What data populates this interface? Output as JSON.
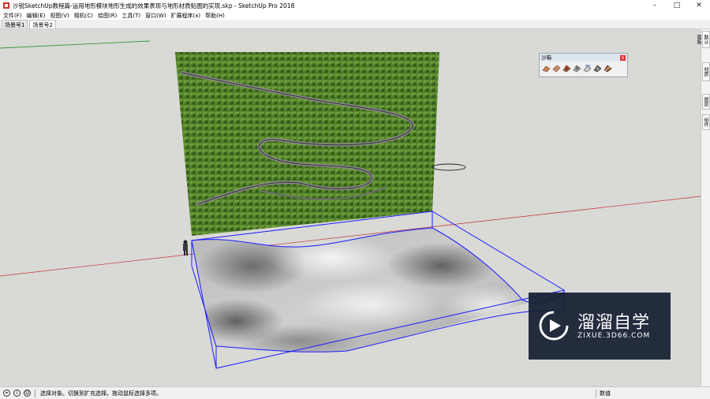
{
  "window": {
    "title": "沙锐SketchUp教程篇-运用地形模块地形生成的效果表现与地形材质贴图的实现.skp - SketchUp Pro 2018",
    "minimize": "–",
    "maximize": "□",
    "close": "✕"
  },
  "menu": {
    "items": [
      "文件(F)",
      "编辑(E)",
      "视图(V)",
      "相机(C)",
      "绘图(R)",
      "工具(T)",
      "窗口(W)",
      "扩展程序(x)",
      "帮助(H)"
    ]
  },
  "scenes": {
    "tabs": [
      "场景号1",
      "场景号2"
    ]
  },
  "sandbox": {
    "title": "沙箱",
    "close": "x",
    "tools": [
      "from-contours-icon",
      "from-scratch-icon",
      "smoove-icon",
      "stamp-icon",
      "drape-icon",
      "add-detail-icon",
      "flip-edge-icon"
    ]
  },
  "tray": {
    "tabs": [
      "默认面板",
      "材质",
      "图层",
      "组件"
    ]
  },
  "status": {
    "message": "选择对象。切换到扩充选择。拖动鼠标选择多项。",
    "measure_label": "数值"
  },
  "watermark": {
    "title": "溜溜自学",
    "url": "ZIXUE.3D66.COM"
  },
  "colors": {
    "viewport_bg": "#d9d9d6",
    "selection_blue": "#1a1aff",
    "axis_red": "#c03030",
    "axis_green": "#3a9a3a"
  }
}
